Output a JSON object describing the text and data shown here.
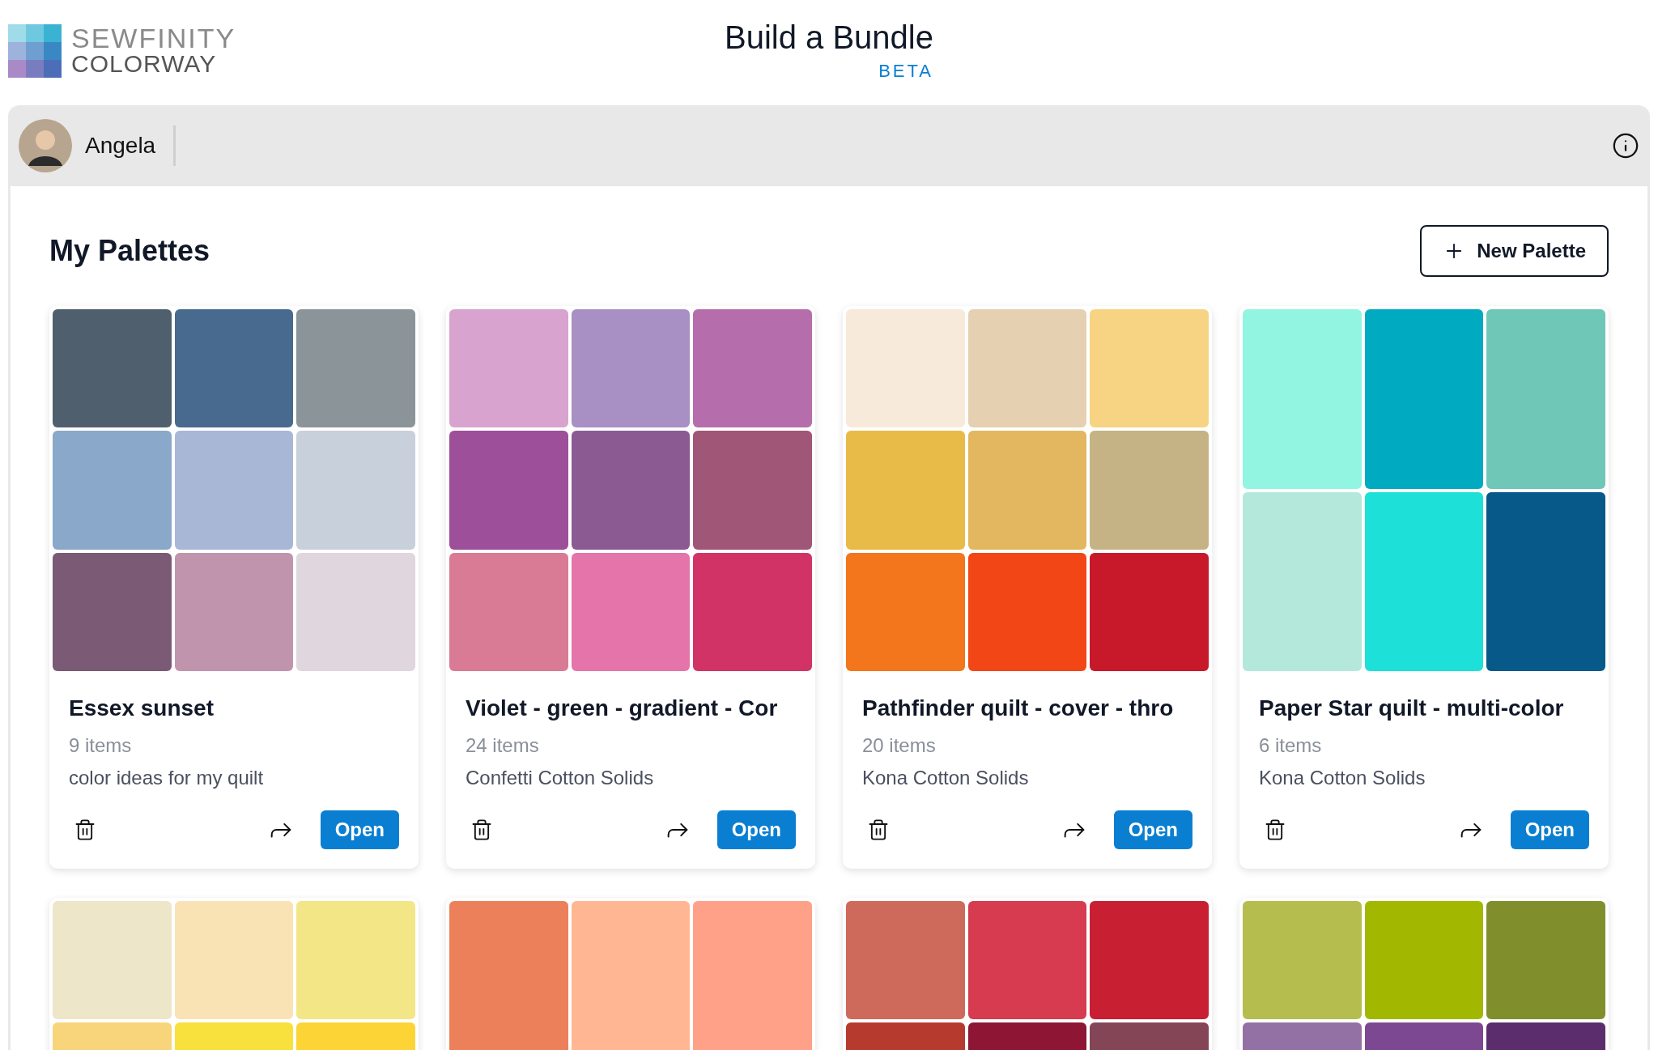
{
  "header": {
    "logo_line_1": "SEWFINITY",
    "logo_line_2": "COLORWAY",
    "title": "Build a Bundle",
    "badge": "BETA"
  },
  "user_bar": {
    "name": "Angela"
  },
  "section": {
    "title": "My Palettes",
    "new_button": "New Palette"
  },
  "palettes": [
    {
      "name": "Essex sunset",
      "count": "9 items",
      "description": "color ideas for my quilt",
      "open": "Open",
      "swatches": [
        {
          "color": "#4f5f6d"
        },
        {
          "color": "#476a8e"
        },
        {
          "color": "#8a9499"
        },
        {
          "color": "#8aa8c9"
        },
        {
          "color": "#a9b7d6"
        },
        {
          "color": "#c8d0dc"
        },
        {
          "color": "#7a5a74"
        },
        {
          "color": "#c194ae"
        },
        {
          "color": "#e0d6dd"
        }
      ]
    },
    {
      "name": "Violet - green - gradient - Cor",
      "count": "24 items",
      "description": "Confetti Cotton Solids",
      "open": "Open",
      "swatches": [
        {
          "color": "#d8a3cf"
        },
        {
          "color": "#a88fc4"
        },
        {
          "color": "#b56eab"
        },
        {
          "color": "#9e4f9a"
        },
        {
          "color": "#8c5a92"
        },
        {
          "color": "#9f5677"
        },
        {
          "color": "#d97b95"
        },
        {
          "color": "#e574aa"
        },
        {
          "color": "#d23366"
        }
      ]
    },
    {
      "name": "Pathfinder quilt - cover - thro",
      "count": "20 items",
      "description": "Kona Cotton Solids",
      "open": "Open",
      "swatches": [
        {
          "color": "#f8eadb"
        },
        {
          "color": "#e5d0b1"
        },
        {
          "color": "#f6d484"
        },
        {
          "color": "#e8bb48"
        },
        {
          "color": "#e2b760"
        },
        {
          "color": "#c6b385"
        },
        {
          "color": "#f3751c"
        },
        {
          "color": "#f24616"
        },
        {
          "color": "#c8192b"
        }
      ]
    },
    {
      "name": "Paper Star quilt - multi-color",
      "count": "6 items",
      "description": "Kona Cotton Solids",
      "open": "Open",
      "swatches": [
        {
          "color": "#92f5e2"
        },
        {
          "color": "#00aac0"
        },
        {
          "color": "#6fc7b8"
        },
        {
          "color": "#b3e8db"
        },
        {
          "color": "#1de0d8"
        },
        {
          "color": "#065988"
        }
      ]
    },
    {
      "swatches": [
        {
          "color": "#ede6c9"
        },
        {
          "color": "#f9e3b5"
        },
        {
          "color": "#f3e687"
        },
        {
          "color": "#f8d57a"
        },
        {
          "color": "#f8e13c"
        },
        {
          "color": "#fdd436"
        }
      ]
    },
    {
      "swatches": [
        {
          "color": "#ec805b"
        },
        {
          "color": "#ffb793"
        },
        {
          "color": "#ffa088"
        }
      ]
    },
    {
      "swatches": [
        {
          "color": "#cd6a5b"
        },
        {
          "color": "#d63b50"
        },
        {
          "color": "#c91f33"
        },
        {
          "color": "#b73a2e"
        },
        {
          "color": "#8e1533"
        },
        {
          "color": "#844656"
        }
      ]
    },
    {
      "swatches": [
        {
          "color": "#b5bd4e"
        },
        {
          "color": "#a2b800"
        },
        {
          "color": "#808f2c"
        },
        {
          "color": "#9471a4"
        },
        {
          "color": "#7c4892"
        },
        {
          "color": "#5b2d6c"
        }
      ]
    }
  ]
}
